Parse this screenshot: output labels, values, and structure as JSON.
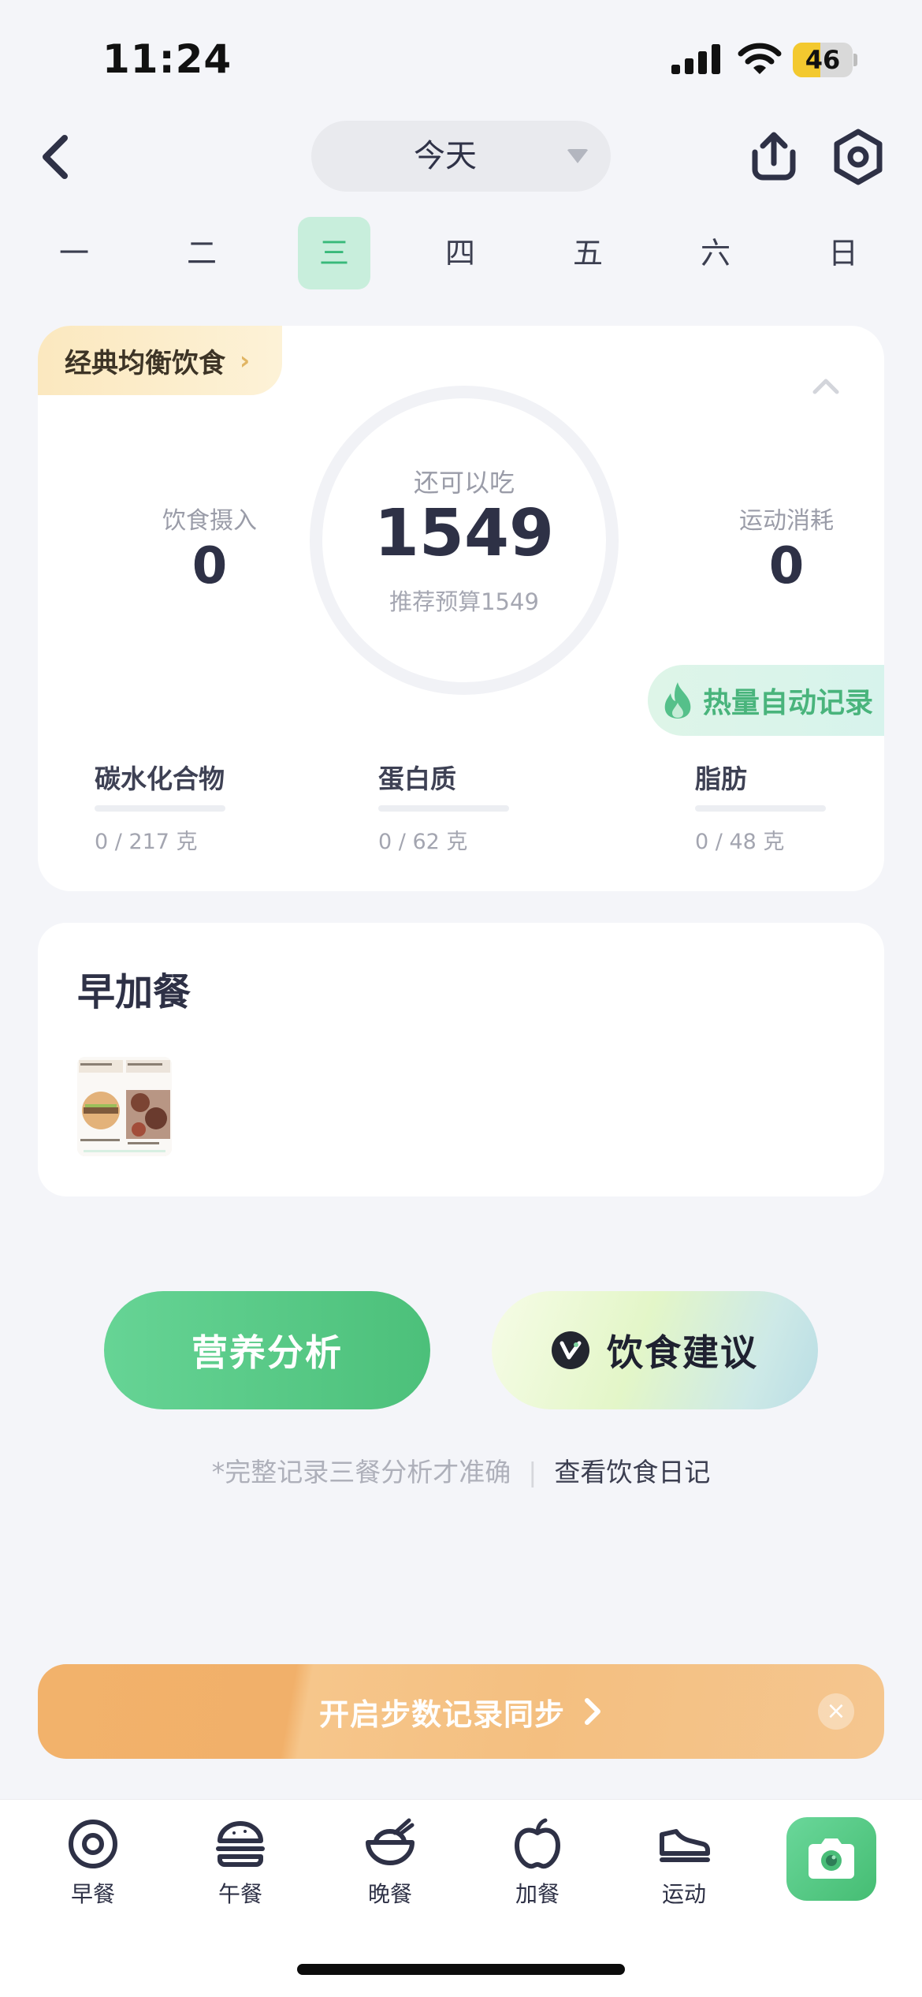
{
  "status_bar": {
    "time": "11:24",
    "battery": "46",
    "battery_level": 0.46
  },
  "header": {
    "date_label": "今天",
    "icons": [
      "back-icon",
      "share-icon",
      "settings-icon"
    ]
  },
  "week": {
    "days": [
      "一",
      "二",
      "三",
      "四",
      "五",
      "六",
      "日"
    ],
    "selected_index": 2
  },
  "summary": {
    "plan_tag": "经典均衡饮食",
    "intake_label": "饮食摄入",
    "intake_value": "0",
    "remaining_label": "还可以吃",
    "remaining_value": "1549",
    "budget_text": "推荐预算1549",
    "exercise_label": "运动消耗",
    "exercise_value": "0",
    "auto_record": "热量自动记录",
    "macros": [
      {
        "label": "碳水化合物",
        "value": "0 / 217 克",
        "progress": 0
      },
      {
        "label": "蛋白质",
        "value": "0 / 62 克",
        "progress": 0
      },
      {
        "label": "脂肪",
        "value": "0 / 48 克",
        "progress": 0
      }
    ]
  },
  "meal": {
    "title": "早加餐"
  },
  "actions": {
    "analysis": "营养分析",
    "advice": "饮食建议",
    "hint": "*完整记录三餐分析才准确",
    "diary": "查看饮食日记"
  },
  "banner": {
    "text": "开启步数记录同步",
    "close": "×"
  },
  "tabbar": {
    "items": [
      {
        "label": "早餐",
        "icon": "egg-icon"
      },
      {
        "label": "午餐",
        "icon": "burger-icon"
      },
      {
        "label": "晚餐",
        "icon": "rice-bowl-icon"
      },
      {
        "label": "加餐",
        "icon": "apple-icon"
      },
      {
        "label": "运动",
        "icon": "sneaker-icon"
      }
    ],
    "camera_icon": "camera-icon"
  },
  "colors": {
    "accent_green": "#4cc07a",
    "banner_orange": "#f2b26b",
    "background": "#f4f5f9"
  }
}
